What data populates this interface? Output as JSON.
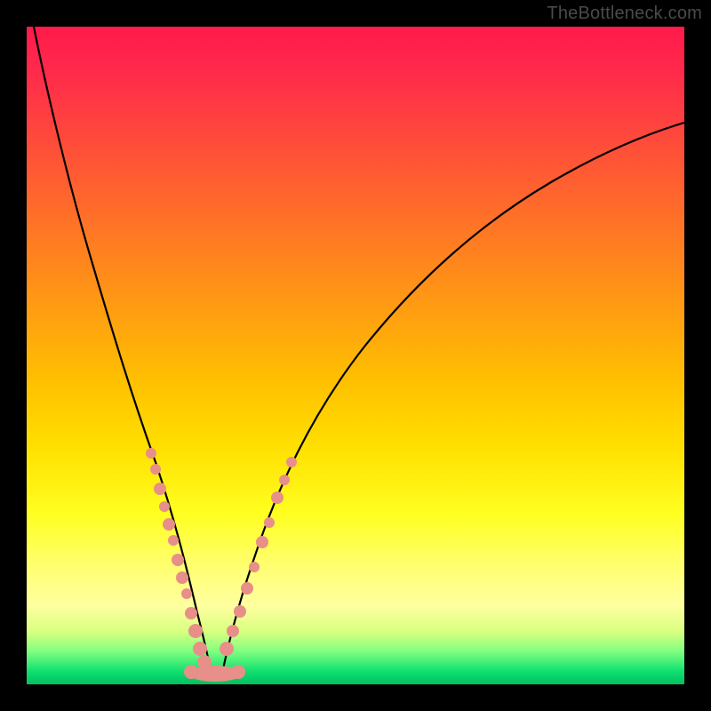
{
  "watermark": "TheBottleneck.com",
  "colors": {
    "frame": "#000000",
    "blob": "#e78f89",
    "curve": "#000000"
  },
  "chart_data": {
    "type": "line",
    "title": "",
    "xlabel": "",
    "ylabel": "",
    "xlim": [
      0,
      100
    ],
    "ylim": [
      0,
      100
    ],
    "grid": false,
    "series": [
      {
        "name": "curve",
        "x": [
          0,
          3,
          6,
          10,
          14,
          18,
          22,
          24,
          26,
          28,
          30,
          34,
          38,
          44,
          50,
          56,
          62,
          70,
          80,
          90,
          100
        ],
        "y": [
          100,
          85,
          72,
          58,
          46,
          34,
          21,
          13,
          5,
          1,
          2,
          8,
          20,
          37,
          51,
          61,
          68,
          74,
          79,
          82,
          84
        ],
        "note": "values estimated from pixels; y=0 at bottom green band, y=100 at top edge"
      },
      {
        "name": "left-dot-cluster",
        "type": "scatter",
        "x": [
          18,
          19,
          20,
          20.5,
          21,
          22,
          22.5,
          23,
          23.5,
          24,
          24.5,
          25,
          26,
          26.5,
          27,
          27.5,
          28
        ],
        "y": [
          33,
          32,
          29,
          28,
          25,
          22,
          20,
          16,
          14,
          12,
          9,
          7,
          5,
          4,
          3,
          2.5,
          2
        ]
      },
      {
        "name": "right-dot-cluster",
        "type": "scatter",
        "x": [
          30,
          30.5,
          31,
          32,
          32.5,
          33,
          33.5,
          34,
          35,
          36,
          37,
          38
        ],
        "y": [
          2,
          4,
          6,
          11,
          15,
          17,
          20,
          22,
          25,
          28,
          31,
          33
        ]
      },
      {
        "name": "bottom-flat-cluster",
        "type": "scatter",
        "x": [
          25,
          26,
          27,
          28,
          29,
          30,
          31,
          32
        ],
        "y": [
          1.5,
          1.5,
          1.5,
          1.5,
          1.5,
          1.5,
          1.5,
          1.5
        ]
      }
    ]
  }
}
